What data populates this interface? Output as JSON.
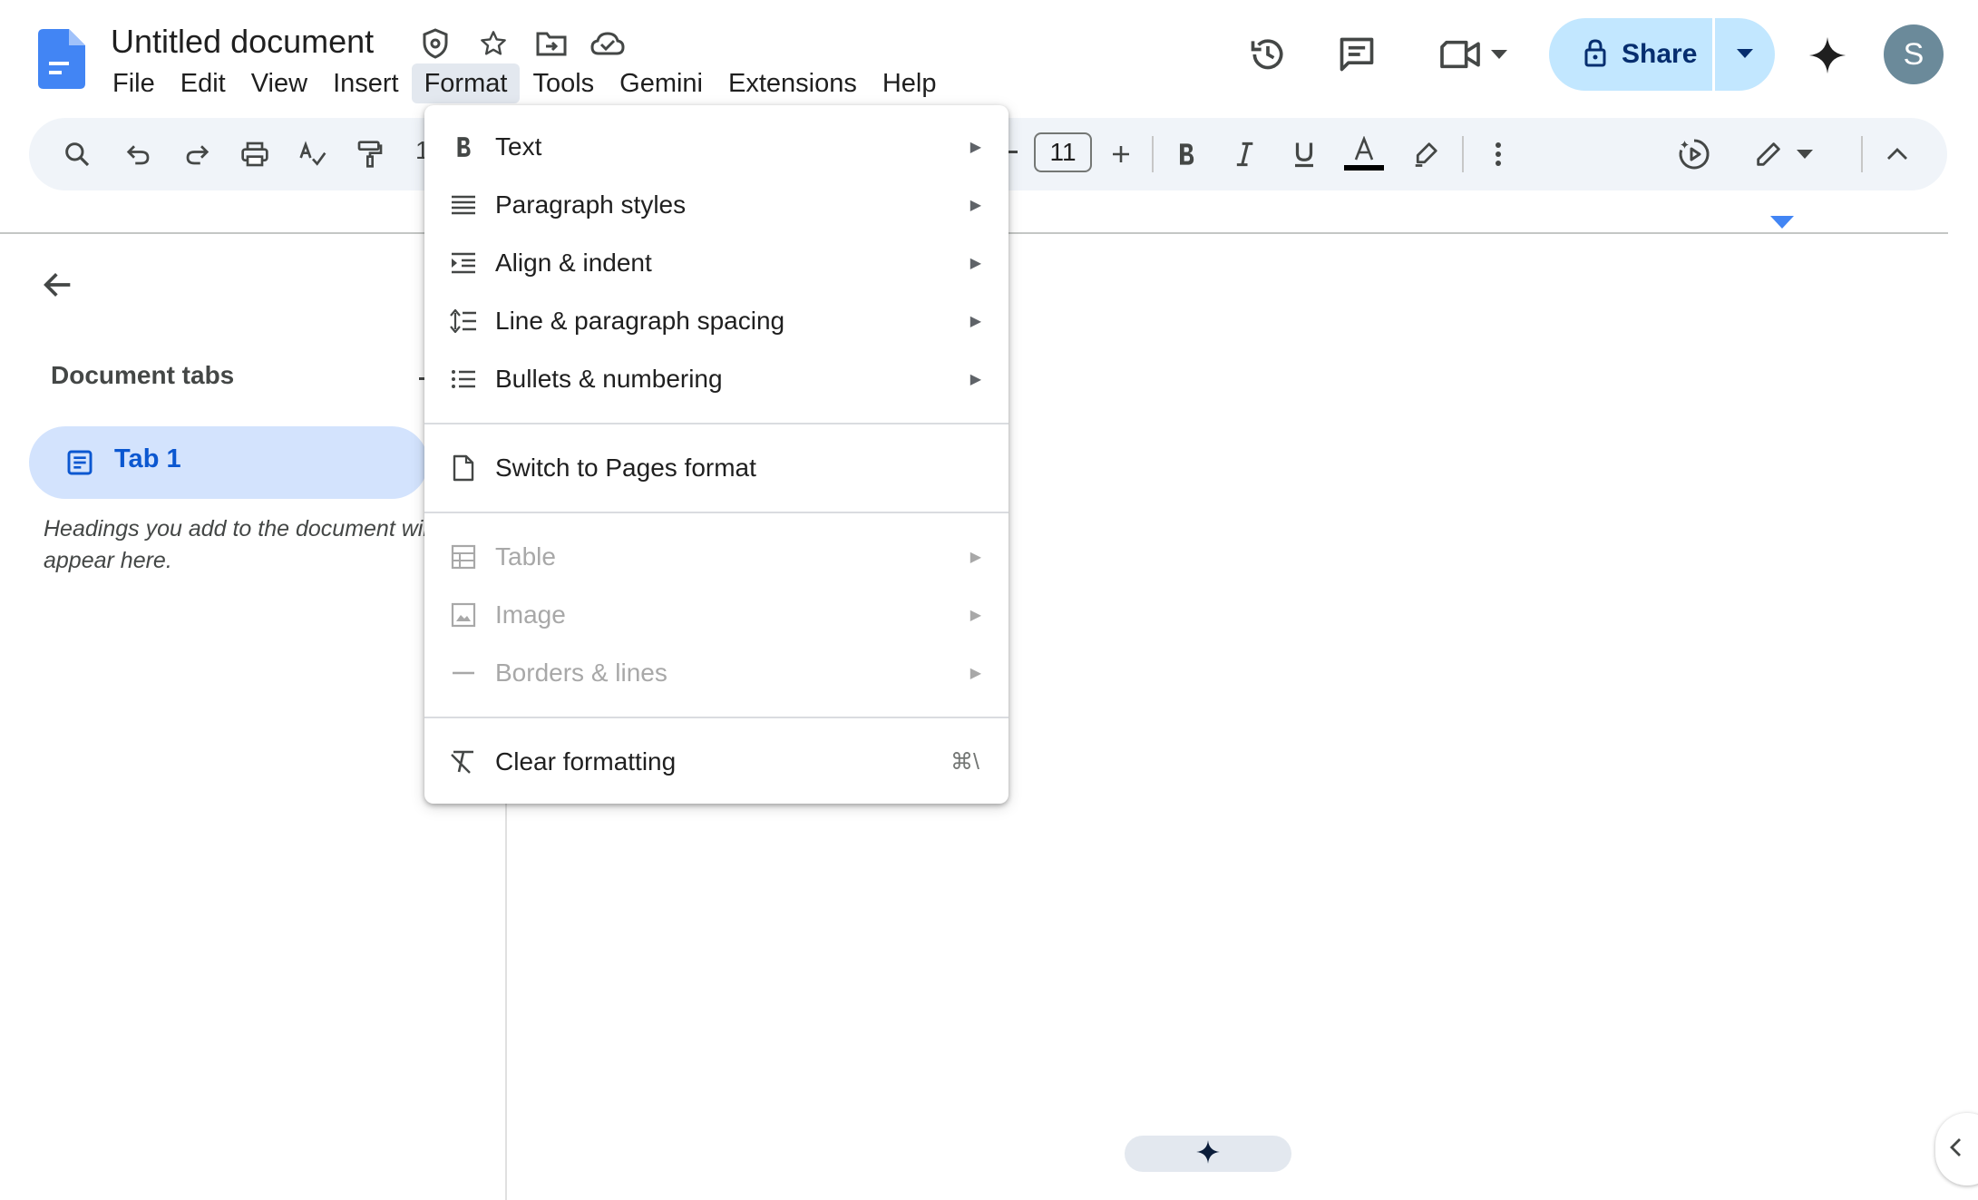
{
  "document": {
    "title": "Untitled document"
  },
  "menubar": {
    "items": [
      {
        "label": "File"
      },
      {
        "label": "Edit"
      },
      {
        "label": "View"
      },
      {
        "label": "Insert"
      },
      {
        "label": "Format",
        "active": true
      },
      {
        "label": "Tools"
      },
      {
        "label": "Gemini"
      },
      {
        "label": "Extensions"
      },
      {
        "label": "Help"
      }
    ]
  },
  "header": {
    "share_label": "Share",
    "avatar_initial": "S",
    "share_color": "#c2e7ff"
  },
  "toolbar": {
    "font_size": "11",
    "text_color": "#000000"
  },
  "sidebar": {
    "heading": "Document tabs",
    "tabs": [
      {
        "label": "Tab 1"
      }
    ],
    "hint": "Headings you add to the document will appear here."
  },
  "format_menu": {
    "items": [
      {
        "label": "Text",
        "icon": "bold-icon",
        "submenu": true
      },
      {
        "label": "Paragraph styles",
        "icon": "paragraph-styles-icon",
        "submenu": true
      },
      {
        "label": "Align & indent",
        "icon": "indent-icon",
        "submenu": true
      },
      {
        "label": "Line & paragraph spacing",
        "icon": "line-spacing-icon",
        "submenu": true
      },
      {
        "label": "Bullets & numbering",
        "icon": "bullet-list-icon",
        "submenu": true
      },
      {
        "label": "Switch to Pages format",
        "icon": "page-icon"
      },
      {
        "label": "Table",
        "icon": "table-icon",
        "submenu": true,
        "disabled": true
      },
      {
        "label": "Image",
        "icon": "image-icon",
        "submenu": true,
        "disabled": true
      },
      {
        "label": "Borders & lines",
        "icon": "line-icon",
        "submenu": true,
        "disabled": true
      },
      {
        "label": "Clear formatting",
        "icon": "clear-formatting-icon",
        "shortcut": "⌘\\"
      }
    ]
  }
}
